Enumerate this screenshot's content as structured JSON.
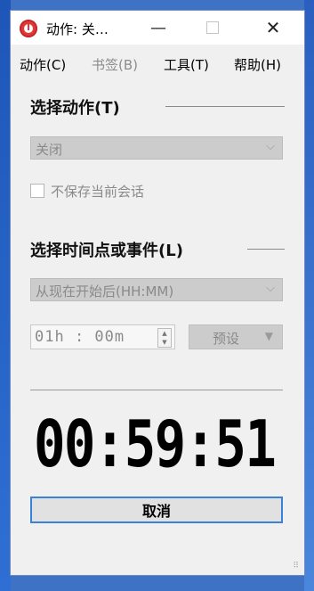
{
  "window": {
    "title": "动作:  关…",
    "controls": {
      "minimize": "—",
      "maximize": "☐",
      "close": "✕"
    }
  },
  "menubar": {
    "items": [
      {
        "label": "动作(C)",
        "enabled": true
      },
      {
        "label": "书签(B)",
        "enabled": false
      },
      {
        "label": "工具(T)",
        "enabled": true
      },
      {
        "label": "帮助(H)",
        "enabled": true
      }
    ]
  },
  "action_section": {
    "title": "选择动作(T)",
    "dropdown_value": "关闭",
    "checkbox_label": "不保存当前会话",
    "checkbox_checked": false
  },
  "time_section": {
    "title": "选择时间点或事件(L)",
    "dropdown_value": "从现在开始后(HH:MM)",
    "time_value": "01h : 00m",
    "preset_label": "预设"
  },
  "countdown": "00:59:51",
  "cancel_button": "取消",
  "colors": {
    "window_bg": "#f0f0f0",
    "accent": "#3a82d8",
    "icon_red": "#e0393a",
    "disabled_text": "#8a8a8a"
  }
}
